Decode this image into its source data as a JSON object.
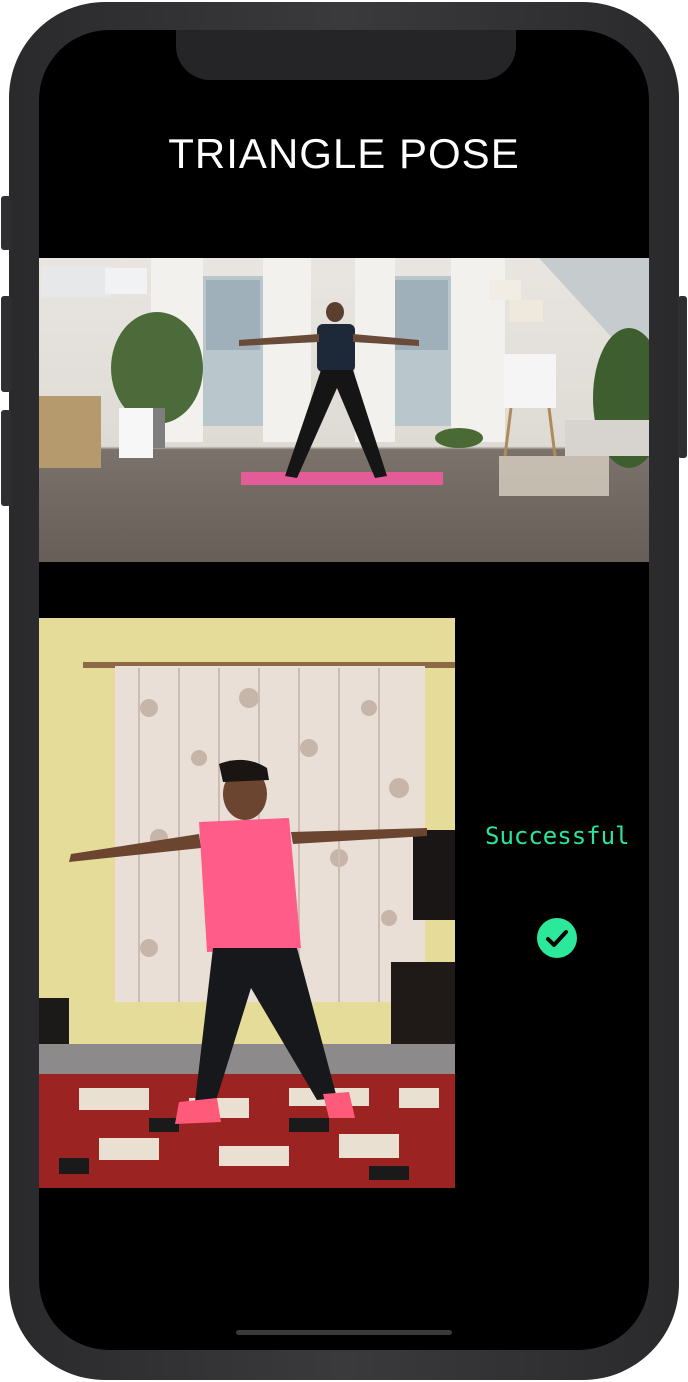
{
  "pose": {
    "title": "TRIANGLE POSE"
  },
  "result": {
    "status": "Successful",
    "status_icon": "check-circle-icon"
  },
  "colors": {
    "accent": "#2ce89b",
    "background": "#000000",
    "title": "#ffffff"
  }
}
